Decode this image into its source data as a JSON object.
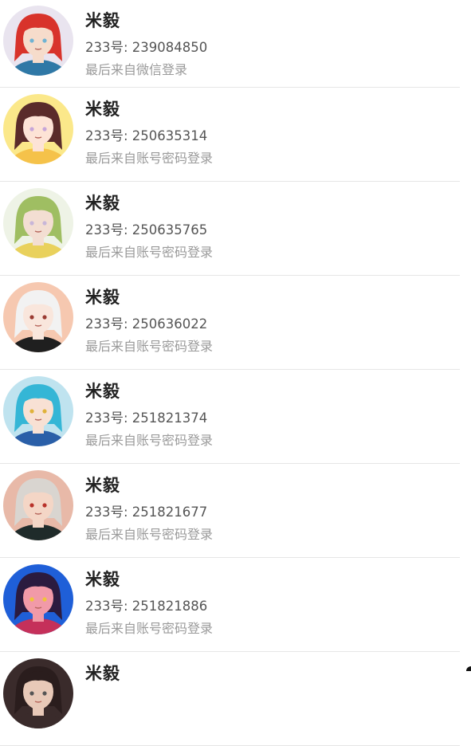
{
  "accounts": [
    {
      "name": "米毅",
      "uid_label": "233号: 239084850",
      "login_source": "最后来自微信登录",
      "avatar_colors": {
        "bg": "#e9e4ef",
        "hair": "#d8332b",
        "skin": "#f6dccb",
        "cloth": "#2f78a6",
        "accent": "#6fb3d3"
      }
    },
    {
      "name": "米毅",
      "uid_label": "233号: 250635314",
      "login_source": "最后来自账号密码登录",
      "avatar_colors": {
        "bg": "#fbe88a",
        "hair": "#5a2b2a",
        "skin": "#fde3d6",
        "cloth": "#f5c24a",
        "accent": "#c7a6d9"
      }
    },
    {
      "name": "米毅",
      "uid_label": "233号: 250635765",
      "login_source": "最后来自账号密码登录",
      "avatar_colors": {
        "bg": "#eef3e6",
        "hair": "#9fbe62",
        "skin": "#f3ded2",
        "cloth": "#e9d15c",
        "accent": "#c8b6d8"
      }
    },
    {
      "name": "米毅",
      "uid_label": "233号: 250636022",
      "login_source": "最后来自账号密码登录",
      "avatar_colors": {
        "bg": "#f6c8b0",
        "hair": "#f2f2f2",
        "skin": "#f9e6dc",
        "cloth": "#1f1f1f",
        "accent": "#9a3b32"
      }
    },
    {
      "name": "米毅",
      "uid_label": "233号: 251821374",
      "login_source": "最后来自账号密码登录",
      "avatar_colors": {
        "bg": "#bfe3ef",
        "hair": "#34b6d6",
        "skin": "#f8e1d4",
        "cloth": "#2a5fa8",
        "accent": "#e0b23a"
      }
    },
    {
      "name": "米毅",
      "uid_label": "233号: 251821677",
      "login_source": "最后来自账号密码登录",
      "avatar_colors": {
        "bg": "#e8b9a8",
        "hair": "#d9d5d0",
        "skin": "#f4d6c6",
        "cloth": "#1f2b2a",
        "accent": "#b8322a"
      }
    },
    {
      "name": "米毅",
      "uid_label": "233号: 251821886",
      "login_source": "最后来自账号密码登录",
      "avatar_colors": {
        "bg": "#1f5fd8",
        "hair": "#2b1b3f",
        "skin": "#f19aa8",
        "cloth": "#c5305a",
        "accent": "#f0c53a"
      }
    },
    {
      "name": "米毅",
      "uid_label": "",
      "login_source": "",
      "avatar_colors": {
        "bg": "#3a2b2b",
        "hair": "#2a1d1d",
        "skin": "#e8c9b8",
        "cloth": "#3a2b2b",
        "accent": "#555555"
      }
    }
  ]
}
